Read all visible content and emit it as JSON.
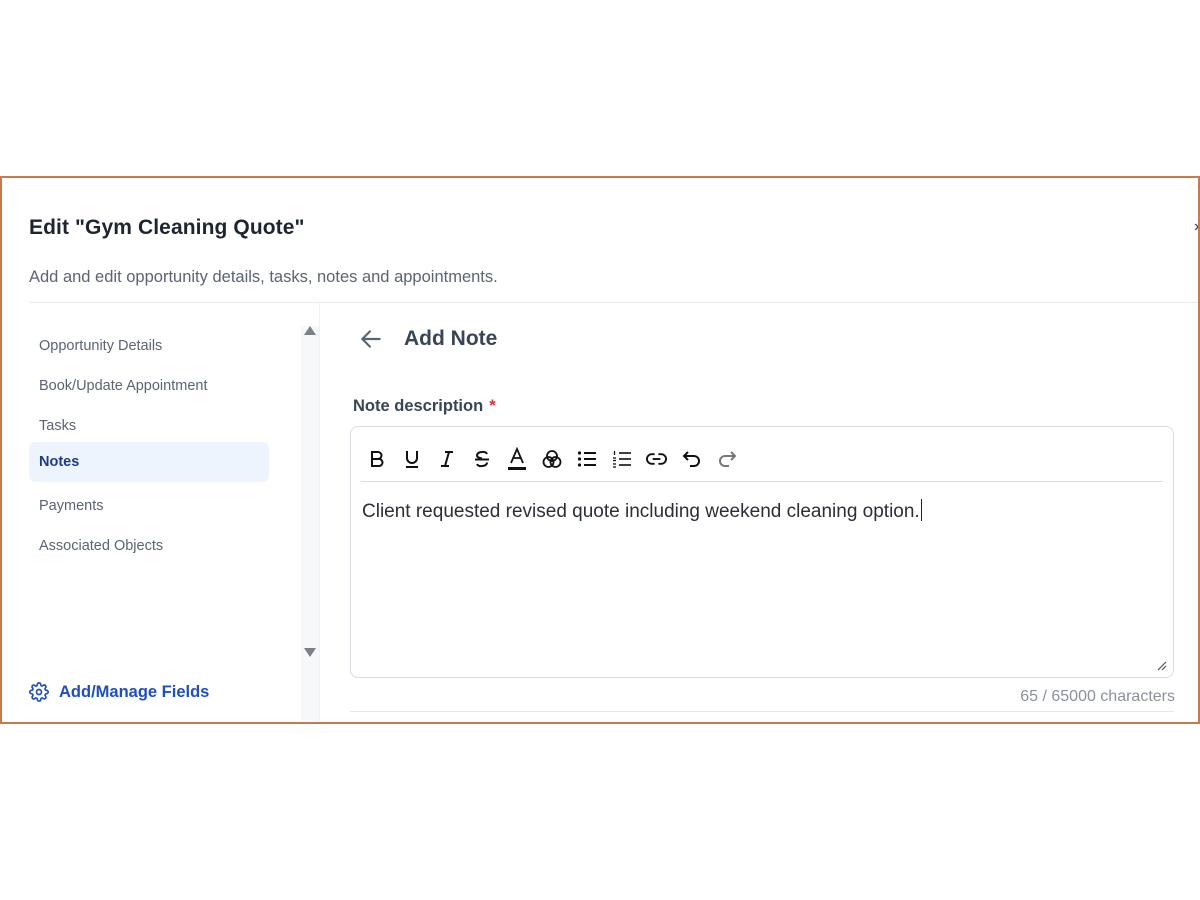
{
  "modal": {
    "title": "Edit \"Gym Cleaning Quote\"",
    "subtitle": "Add and edit opportunity details, tasks, notes and appointments."
  },
  "sidebar": {
    "items": [
      {
        "label": "Opportunity Details",
        "active": false
      },
      {
        "label": "Book/Update Appointment",
        "active": false
      },
      {
        "label": "Tasks",
        "active": false
      },
      {
        "label": "Notes",
        "active": true
      },
      {
        "label": "Payments",
        "active": false
      },
      {
        "label": "Associated Objects",
        "active": false
      }
    ],
    "manage_fields_label": "Add/Manage Fields"
  },
  "main": {
    "title": "Add Note",
    "field_label": "Note description",
    "required_marker": "*",
    "editor_text": "Client requested revised quote including weekend cleaning option.",
    "char_count": "65 / 65000 characters",
    "toolbar_icons": [
      "bold-icon",
      "underline-icon",
      "italic-icon",
      "strikethrough-icon",
      "text-color-icon",
      "highlight-color-icon",
      "bullet-list-icon",
      "numbered-list-icon",
      "link-icon",
      "undo-icon",
      "redo-icon"
    ]
  },
  "colors": {
    "frame_border": "#c87a4f",
    "accent": "#1f4fbf",
    "active_bg": "#eef4fd",
    "required": "#e0322f"
  }
}
